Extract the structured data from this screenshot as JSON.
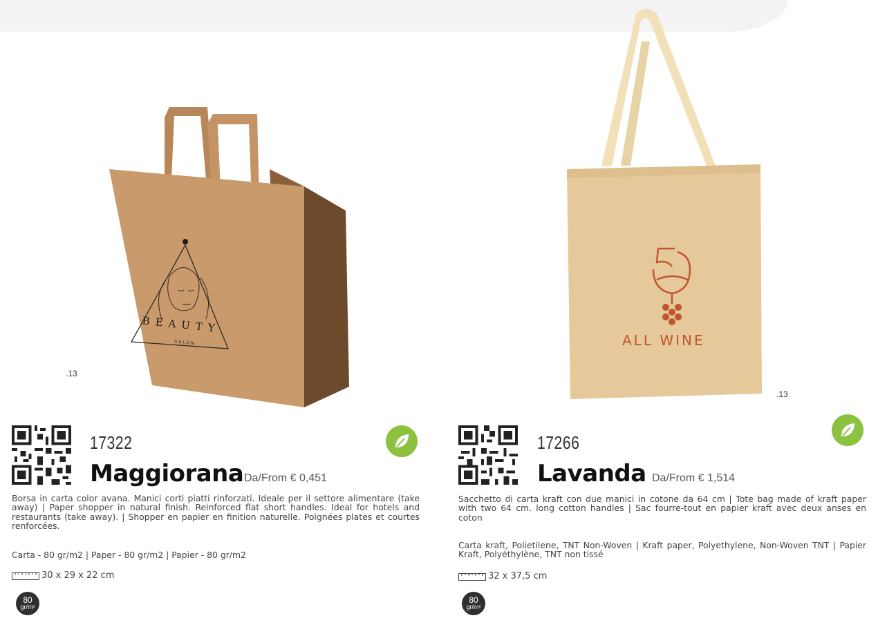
{
  "products": [
    {
      "image_suffix": ".13",
      "code": "17322",
      "name": "Maggiorana",
      "price": "Da/From € 0,451",
      "description": "Borsa in carta color avana. Manici corti piatti rinforzati. Ideale per il settore alimentare (take away) | Paper shopper in natural finish. Reinforced flat short handles. Ideal for hotels and restaurants (take away). | Shopper en papier en finition naturelle. Poignées plates et courtes renforcées.",
      "material": "Carta - 80 gr/m2 | Paper - 80 gr/m2 | Papier - 80 gr/m2",
      "size": "30 x 29 x 22 cm",
      "weight_number": "80",
      "weight_unit": "gr/m²",
      "print_text_1": "BEAUTY",
      "print_text_2": "SALON"
    },
    {
      "image_suffix": ".13",
      "code": "17266",
      "name": "Lavanda",
      "price": "Da/From € 1,514",
      "description": "Sacchetto di carta kraft con due manici in cotone da 64 cm | Tote bag made of kraft paper with two 64 cm. long cotton handles | Sac fourre-tout en papier kraft avec deux anses en coton",
      "material": "Carta kraft, Polietilene, TNT Non-Woven | Kraft paper, Polyethylene, Non-Woven TNT | Papier Kraft, Polyéthylène, TNT non tissé",
      "size": "32 x 37,5 cm",
      "weight_number": "80",
      "weight_unit": "gr/m²",
      "print_text_1": "ALL WINE"
    }
  ],
  "colors": {
    "eco_green": "#8cc23f",
    "kraft": "#c99a6b",
    "tote": "#e6c99a",
    "print_red": "#c0552e"
  },
  "icons": [
    "qr-code-icon",
    "leaf-icon",
    "ruler-icon"
  ]
}
